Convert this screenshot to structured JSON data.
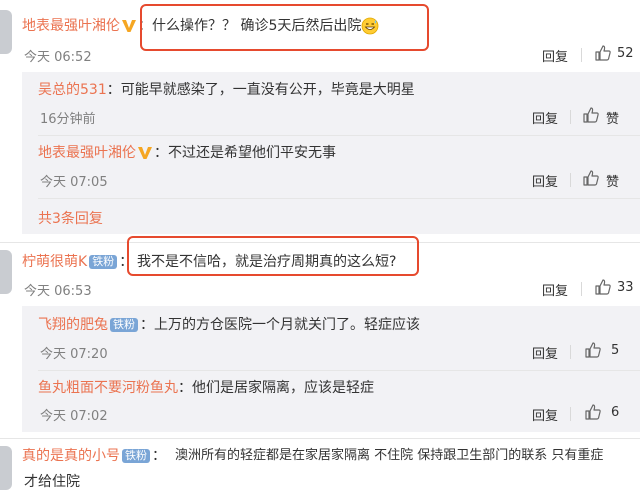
{
  "comments": [
    {
      "user": "地表最强叶湘伦",
      "badge": "v-badge",
      "colon": "：",
      "text": "什么操作？？  确诊5天后然后出院",
      "emoji": "grinning-sweat-emoji",
      "time": "今天 06:52",
      "reply_label": "回复",
      "likes": "52",
      "replies": [
        {
          "user": "吴总的531",
          "colon": "：",
          "text": "可能早就感染了，一直没有公开，毕竟是大明星",
          "time": "16分钟前",
          "reply_label": "回复",
          "likes": "赞"
        },
        {
          "user": "地表最强叶湘伦",
          "badge": "v-badge",
          "colon": "：",
          "text": "不过还是希望他们平安无事",
          "time": "今天 07:05",
          "reply_label": "回复",
          "likes": "赞"
        }
      ],
      "more_label": "共3条回复"
    },
    {
      "user": "柠萌很萌K",
      "fan_badge": "铁粉",
      "colon": "：",
      "text": "我不是不信哈，就是治疗周期真的这么短?",
      "time": "今天 06:53",
      "reply_label": "回复",
      "likes": "33",
      "replies": [
        {
          "user": "飞翔的肥兔",
          "fan_badge": "铁粉",
          "colon": "：",
          "text": "上万的方仓医院一个月就关门了。轻症应该",
          "time": "今天 07:20",
          "reply_label": "回复",
          "likes": "5"
        },
        {
          "user": "鱼丸粗面不要河粉鱼丸",
          "colon": "：",
          "text": "他们是居家隔离，应该是轻症",
          "time": "今天 07:02",
          "reply_label": "回复",
          "likes": "6"
        }
      ]
    },
    {
      "user": "真的是真的小号",
      "fan_badge": "铁粉",
      "colon": "：",
      "text": "澳洲所有的轻症都是在家居家隔离 不住院 保持跟卫生部门的联系 只有重症",
      "text_line2": "才给住院"
    }
  ],
  "colors": {
    "username": "#eb7350",
    "highlight": "#e64a2e",
    "fan_badge": "#7aa5d6",
    "v_badge": "#f5a623"
  }
}
